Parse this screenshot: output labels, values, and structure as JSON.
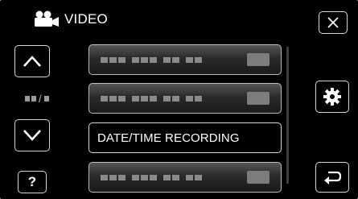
{
  "header": {
    "title": "VIDEO",
    "mode_icon": "video-camera-icon"
  },
  "buttons": {
    "close_icon": "close-icon",
    "up_icon": "chevron-up-icon",
    "down_icon": "chevron-down-icon",
    "help_label": "?",
    "settings_icon": "gear-icon",
    "back_icon": "return-icon"
  },
  "page_indicator": "/",
  "menu": {
    "items": [
      {
        "label": "",
        "state": "greyed"
      },
      {
        "label": "",
        "state": "greyed"
      },
      {
        "label": "DATE/TIME RECORDING",
        "state": "active"
      },
      {
        "label": "",
        "state": "greyed"
      }
    ]
  },
  "colors": {
    "background": "#000000",
    "border": "#d8d8d8",
    "text": "#ffffff",
    "greyed_item": "#2a2a2a"
  }
}
